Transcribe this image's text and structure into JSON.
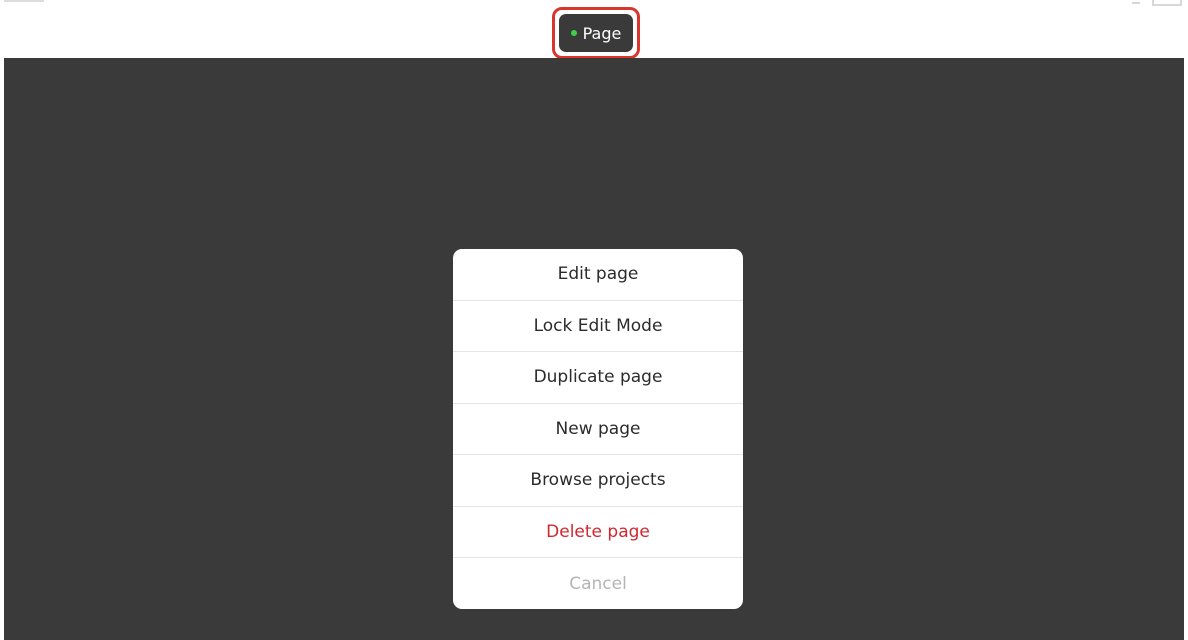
{
  "top_bar": {
    "page_button_label": "Page",
    "status_color": "#3ecf4a",
    "highlight_color": "#d9352b"
  },
  "action_sheet": {
    "items": [
      {
        "label": "Edit page",
        "style": "default"
      },
      {
        "label": "Lock Edit Mode",
        "style": "default"
      },
      {
        "label": "Duplicate page",
        "style": "default"
      },
      {
        "label": "New page",
        "style": "default"
      },
      {
        "label": "Browse projects",
        "style": "default"
      },
      {
        "label": "Delete page",
        "style": "destructive",
        "color": "#d22730"
      },
      {
        "label": "Cancel",
        "style": "cancel"
      }
    ]
  }
}
